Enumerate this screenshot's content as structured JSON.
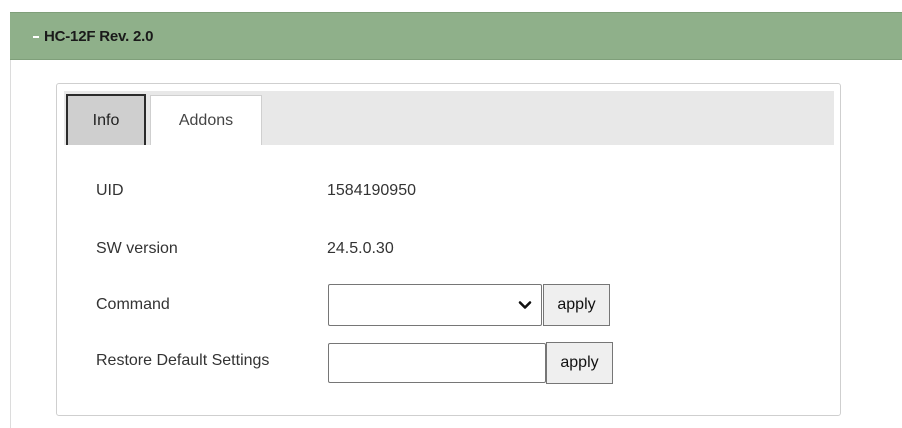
{
  "section": {
    "title": "HC-12F Rev. 2.0",
    "toggle_icon": "collapse-minus-icon"
  },
  "tabs": [
    {
      "label": "Info",
      "active": true
    },
    {
      "label": "Addons",
      "active": false
    }
  ],
  "info": {
    "uid_label": "UID",
    "uid_value": "1584190950",
    "sw_label": "SW version",
    "sw_value": "24.5.0.30",
    "command_label": "Command",
    "command_selected": "",
    "command_apply": "apply",
    "restore_label": "Restore Default Settings",
    "restore_value": "",
    "restore_apply": "apply"
  },
  "colors": {
    "header_bg": "#8fb08a",
    "active_tab_bg": "#cfcfcf",
    "tab_strip_bg": "#e8e8e8"
  }
}
